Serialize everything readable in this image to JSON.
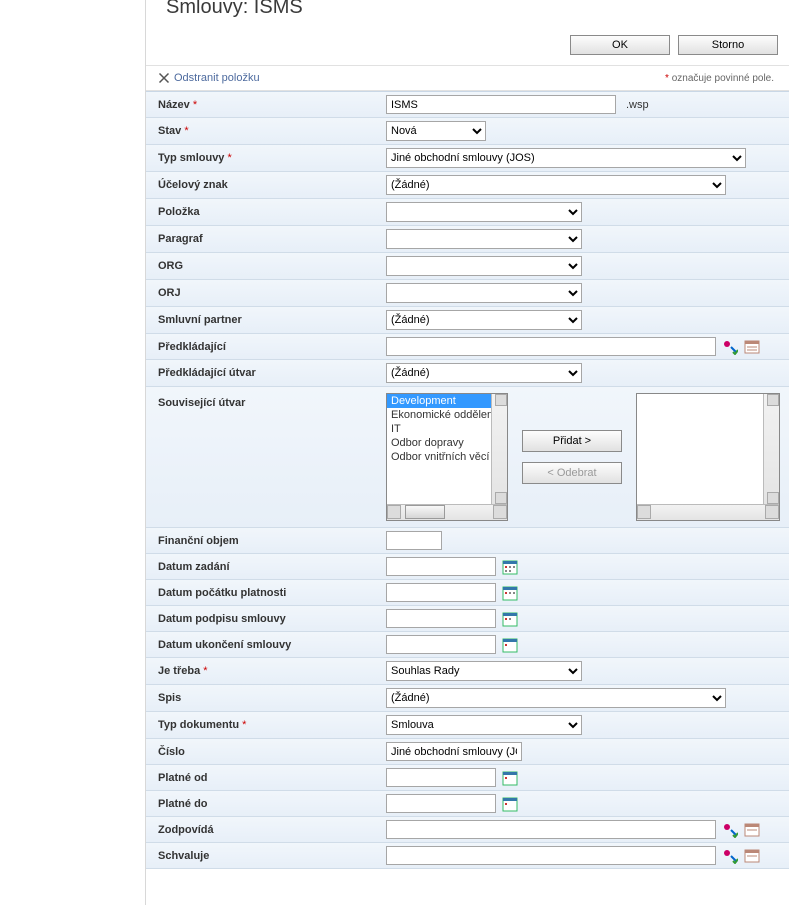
{
  "page_title": "Smlouvy: ISMS",
  "toolbar": {
    "ok": "OK",
    "cancel": "Storno"
  },
  "delete_link": "Odstranit položku",
  "required_note_prefix": "*",
  "required_note_text": " označuje povinné pole.",
  "labels": {
    "nazev": "Název",
    "stav": "Stav",
    "typ_smlouvy": "Typ smlouvy",
    "ucelovy_znak": "Účelový znak",
    "polozka": "Položka",
    "paragraf": "Paragraf",
    "org": "ORG",
    "orj": "ORJ",
    "smluvni_partner": "Smluvní partner",
    "predkladajici": "Předkládající",
    "predkladajici_utvar": "Předkládající útvar",
    "souvisejici_utvar": "Související útvar",
    "financni_objem": "Finanční objem",
    "datum_zadani": "Datum zadání",
    "datum_pocatku": "Datum počátku platnosti",
    "datum_podpisu": "Datum podpisu smlouvy",
    "datum_ukonceni": "Datum ukončení smlouvy",
    "je_treba": "Je třeba",
    "spis": "Spis",
    "typ_dokumentu": "Typ dokumentu",
    "cislo": "Číslo",
    "platne_od": "Platné od",
    "platne_do": "Platné do",
    "zodpovida": "Zodpovídá",
    "schvaluje": "Schvaluje"
  },
  "values": {
    "nazev": "ISMS",
    "nazev_suffix": ".wsp",
    "stav": "Nová",
    "typ_smlouvy": "Jiné obchodní smlouvy (JOS)",
    "ucelovy_znak": "(Žádné)",
    "polozka": "",
    "paragraf": "",
    "org": "",
    "orj": "",
    "smluvni_partner": "(Žádné)",
    "predkladajici": "",
    "predkladajici_utvar": "(Žádné)",
    "financni_objem": "",
    "datum_zadani": "",
    "datum_pocatku": "",
    "datum_podpisu": "",
    "datum_ukonceni": "",
    "je_treba": "Souhlas Rady",
    "spis": "(Žádné)",
    "typ_dokumentu": "Smlouva",
    "cislo": "Jiné obchodní smlouvy (JO",
    "platne_od": "",
    "platne_do": "",
    "zodpovida": "",
    "schvaluje": ""
  },
  "souvisejici_options": [
    "Development",
    "Ekonomické oddělení",
    "IT",
    "Odbor dopravy",
    "Odbor vnitřních věcí"
  ],
  "souvisejici_selected_index": 0,
  "buttons": {
    "pridat": "Přidat >",
    "odebrat": "< Odebrat"
  }
}
